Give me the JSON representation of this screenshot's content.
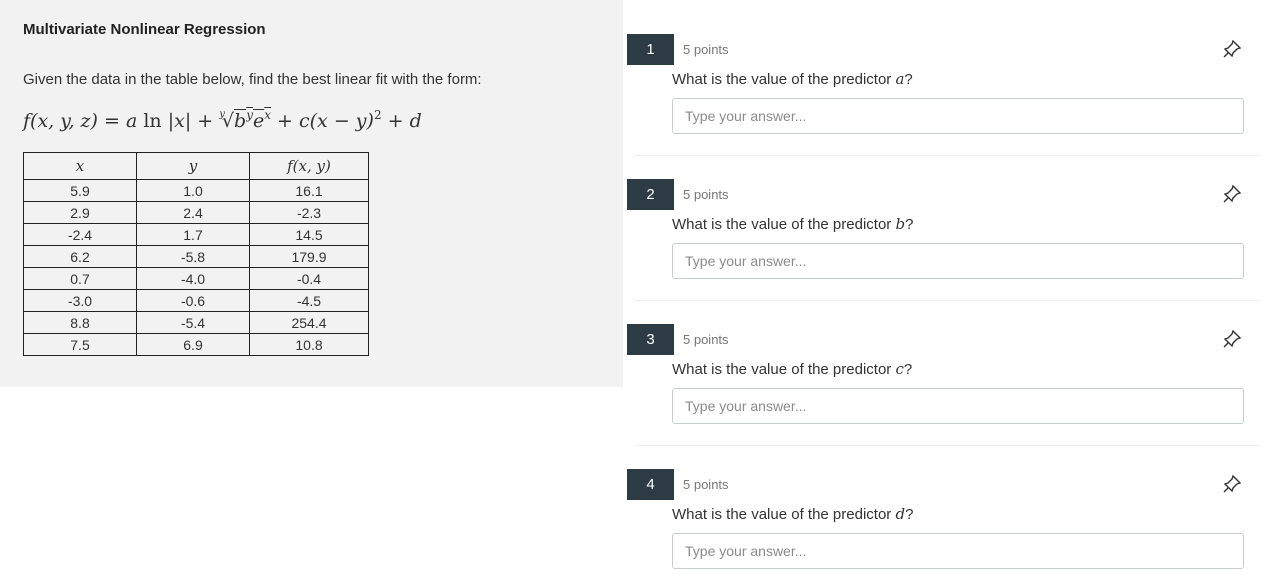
{
  "left": {
    "title": "Multivariate Nonlinear Regression",
    "description": "Given the data in the table below, find the best linear fit with the form:",
    "table": {
      "headers": [
        "x",
        "y",
        "f(x, y)"
      ],
      "rows": [
        [
          "5.9",
          "1.0",
          "16.1"
        ],
        [
          "2.9",
          "2.4",
          "-2.3"
        ],
        [
          "-2.4",
          "1.7",
          "14.5"
        ],
        [
          "6.2",
          "-5.8",
          "179.9"
        ],
        [
          "0.7",
          "-4.0",
          "-0.4"
        ],
        [
          "-3.0",
          "-0.6",
          "-4.5"
        ],
        [
          "8.8",
          "-5.4",
          "254.4"
        ],
        [
          "7.5",
          "6.9",
          "10.8"
        ]
      ]
    }
  },
  "questions": [
    {
      "number": "1",
      "points": "5 points",
      "prompt": "What is the value of the predictor ",
      "var": "a",
      "suffix": "?",
      "placeholder": "Type your answer..."
    },
    {
      "number": "2",
      "points": "5 points",
      "prompt": "What is the value of the predictor ",
      "var": "b",
      "suffix": "?",
      "placeholder": "Type your answer..."
    },
    {
      "number": "3",
      "points": "5 points",
      "prompt": "What is the value of the predictor ",
      "var": "c",
      "suffix": "?",
      "placeholder": "Type your answer..."
    },
    {
      "number": "4",
      "points": "5 points",
      "prompt": "What is the value of the predictor ",
      "var": "d",
      "suffix": "?",
      "placeholder": "Type your answer..."
    }
  ]
}
